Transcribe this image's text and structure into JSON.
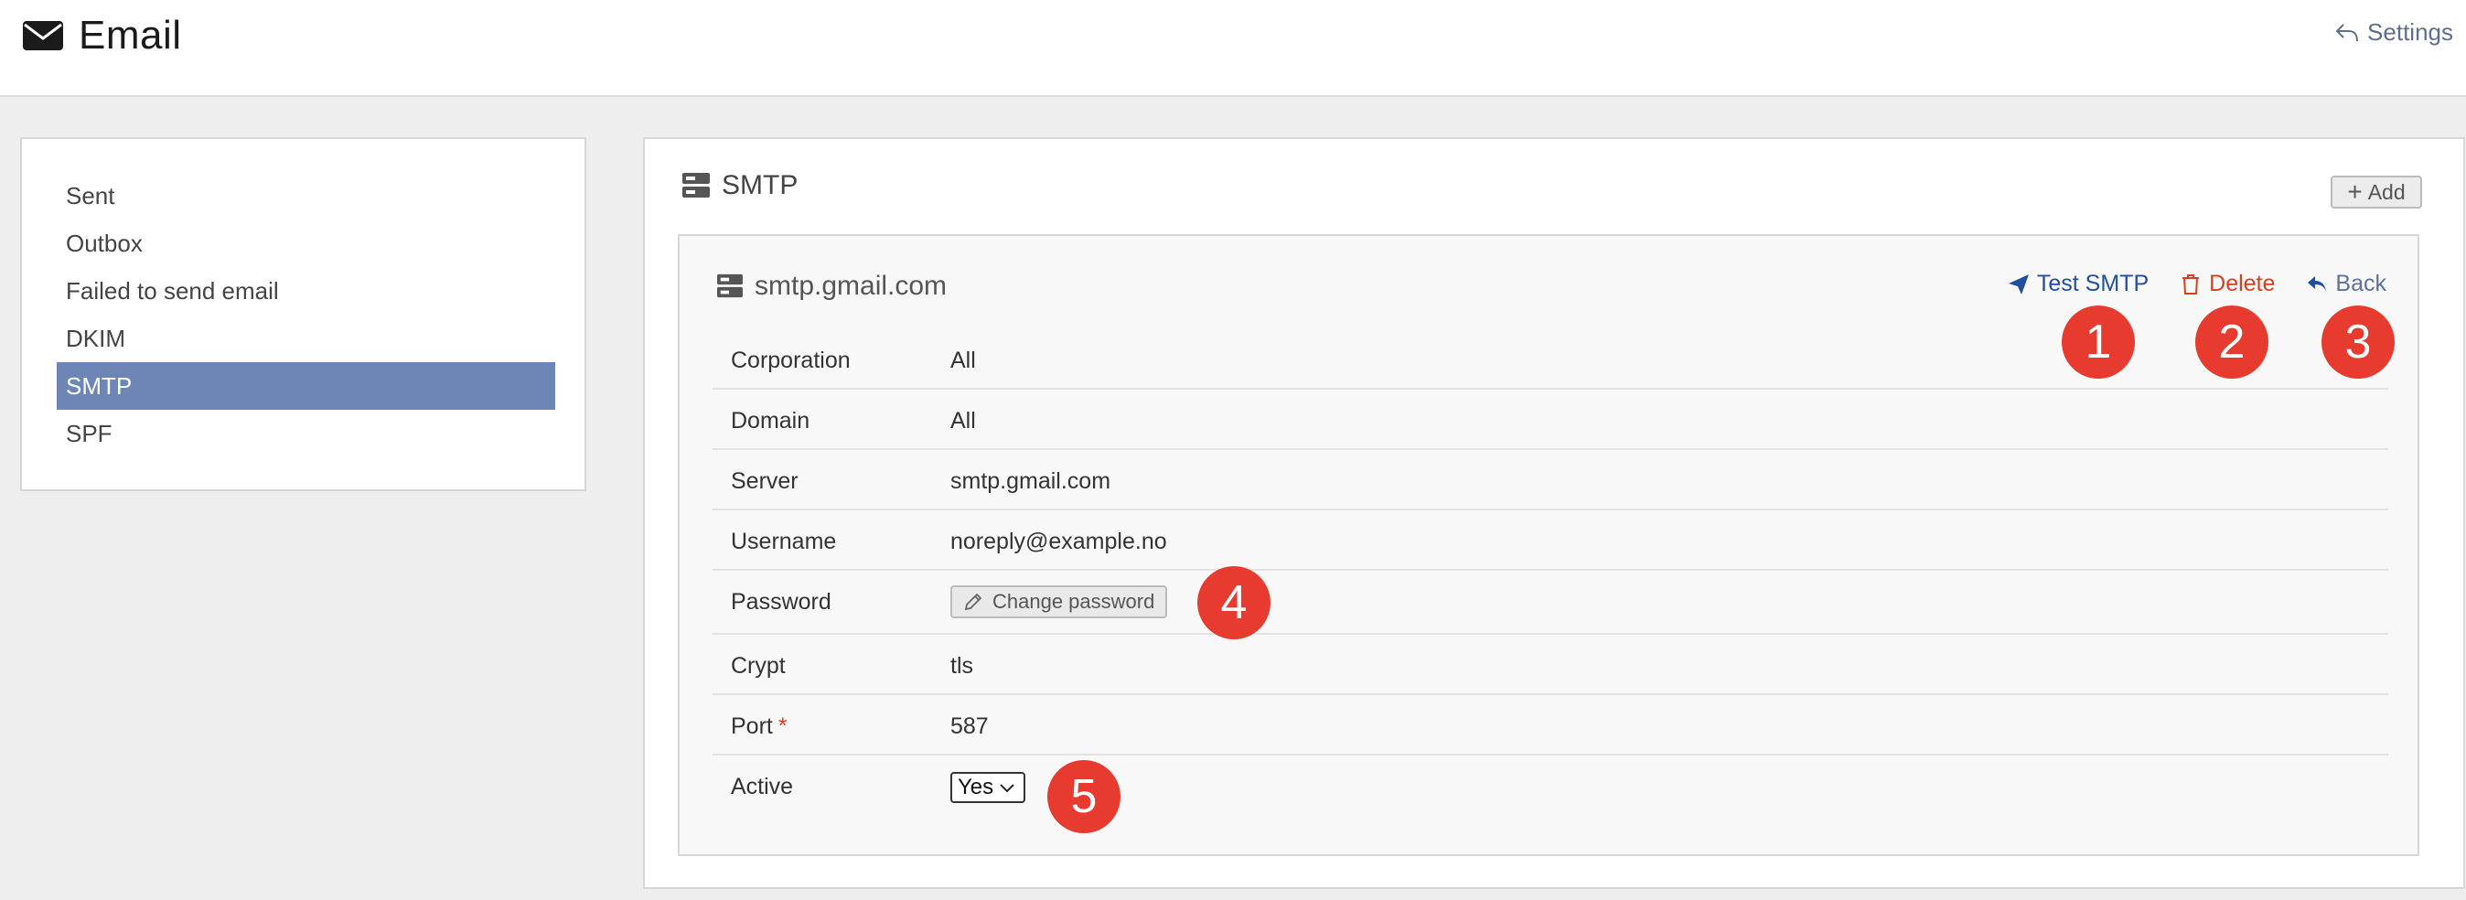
{
  "header": {
    "title": "Email",
    "settings_label": "Settings"
  },
  "sidebar": {
    "items": [
      {
        "label": "Sent"
      },
      {
        "label": "Outbox"
      },
      {
        "label": "Failed to send email"
      },
      {
        "label": "DKIM"
      },
      {
        "label": "SMTP"
      },
      {
        "label": "SPF"
      }
    ],
    "active": "SMTP"
  },
  "panel": {
    "title": "SMTP",
    "add_label": "Add",
    "card": {
      "title": "smtp.gmail.com",
      "actions": {
        "test_label": "Test SMTP",
        "delete_label": "Delete",
        "back_label": "Back"
      },
      "fields": {
        "corporation": {
          "label": "Corporation",
          "value": "All"
        },
        "domain": {
          "label": "Domain",
          "value": "All"
        },
        "server": {
          "label": "Server",
          "value": "smtp.gmail.com"
        },
        "username": {
          "label": "Username",
          "value": "noreply@example.no"
        },
        "password": {
          "label": "Password",
          "button_label": "Change password"
        },
        "crypt": {
          "label": "Crypt",
          "value": "tls"
        },
        "port": {
          "label": "Port",
          "required_mark": "*",
          "value": "587"
        },
        "active": {
          "label": "Active",
          "selected": "Yes"
        }
      }
    }
  },
  "markers": [
    "1",
    "2",
    "3",
    "4",
    "5"
  ],
  "colors": {
    "accent_blue": "#1f4f9e",
    "delete_red": "#d6401f",
    "active_item": "#6e86b5",
    "marker_red": "#e63b2e"
  }
}
